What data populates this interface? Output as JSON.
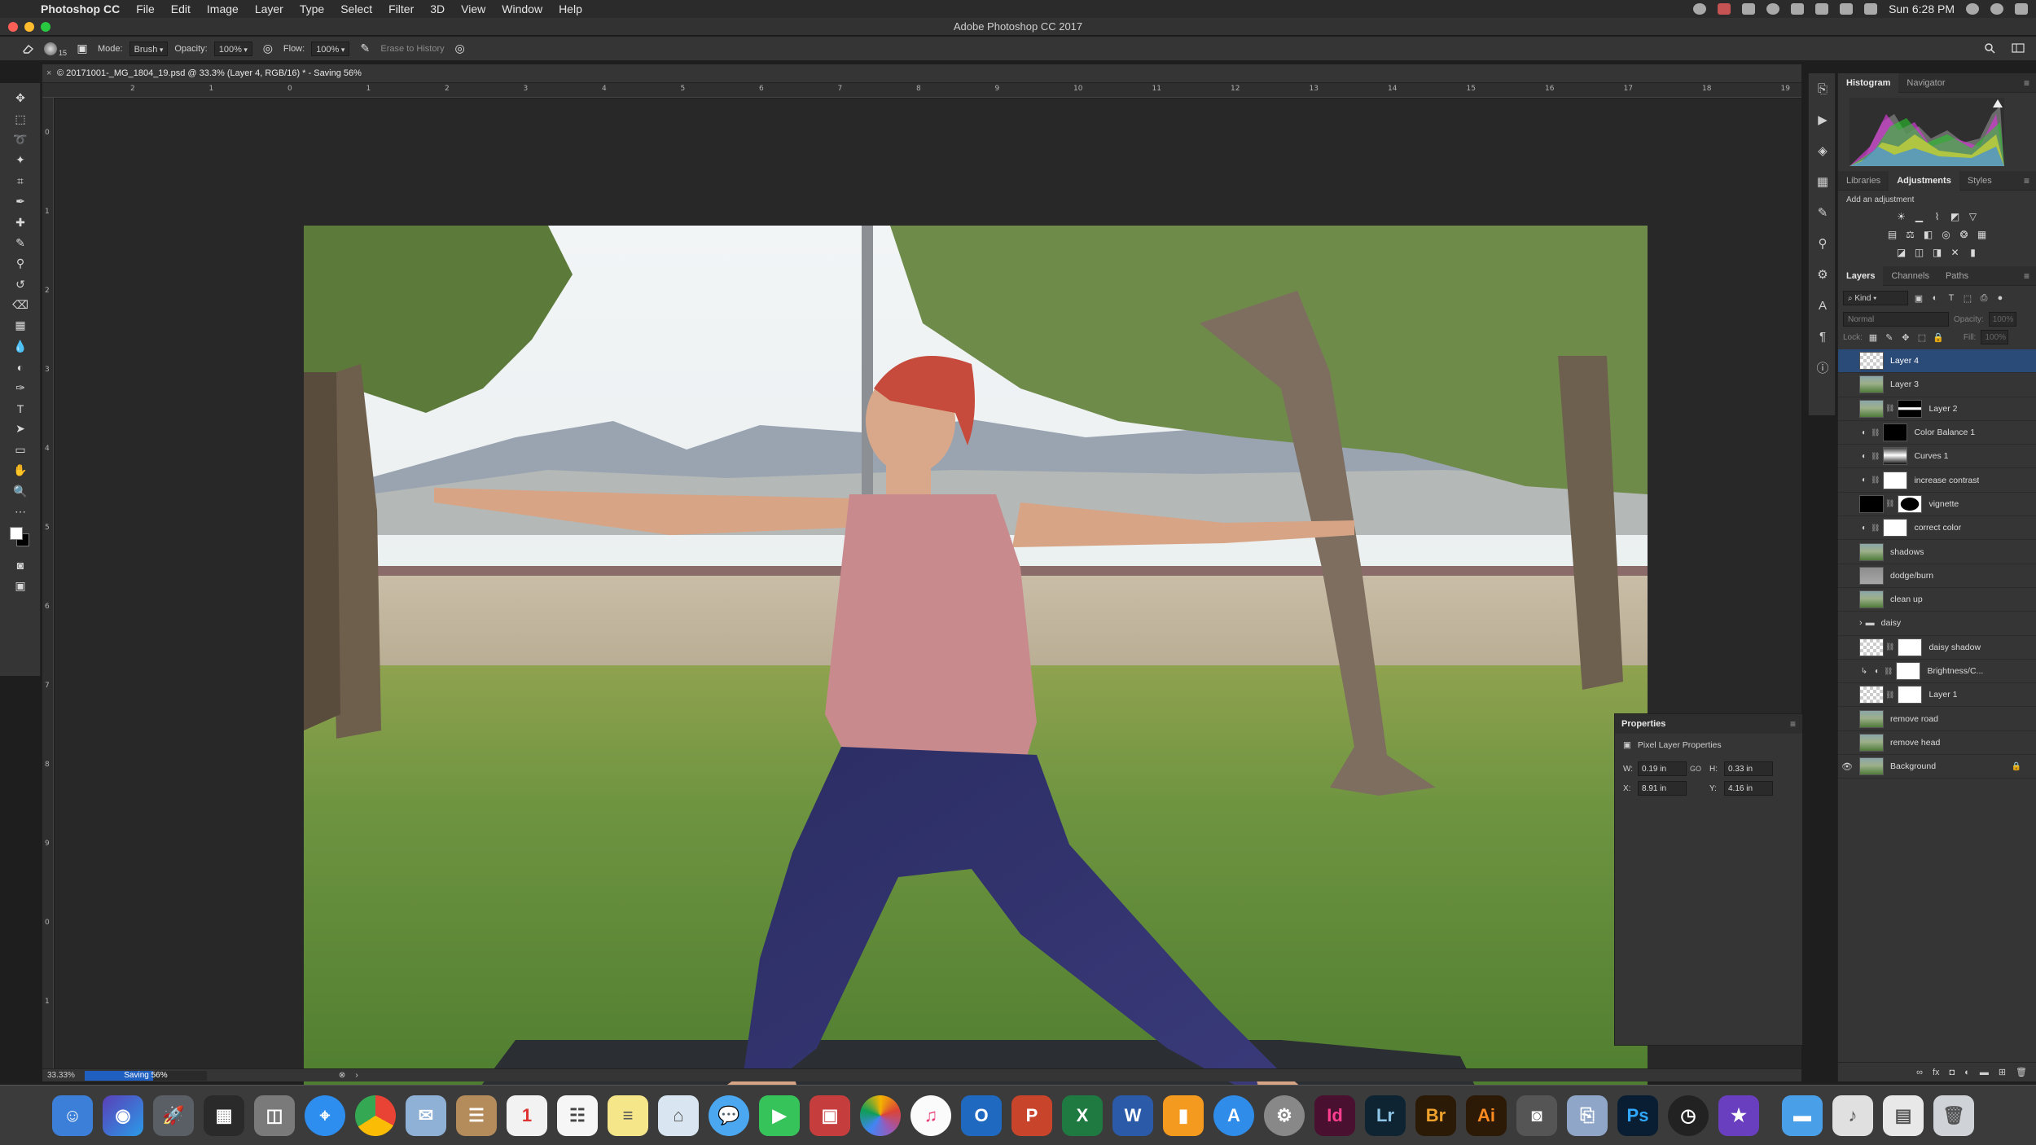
{
  "menubar": {
    "app_name": "Photoshop CC",
    "items": [
      "File",
      "Edit",
      "Image",
      "Layer",
      "Type",
      "Select",
      "Filter",
      "3D",
      "View",
      "Window",
      "Help"
    ],
    "clock": "Sun 6:28 PM"
  },
  "window": {
    "title": "Adobe Photoshop CC 2017"
  },
  "options_bar": {
    "brush_size": "15",
    "mode_label": "Mode:",
    "mode_value": "Brush",
    "opacity_label": "Opacity:",
    "opacity_value": "100%",
    "flow_label": "Flow:",
    "flow_value": "100%",
    "erase_to_history": "Erase to History"
  },
  "document": {
    "tab_title": "© 20171001-_MG_1804_19.psd @ 33.3% (Layer 4, RGB/16) * - Saving 56%"
  },
  "rulers": {
    "h_ticks": [
      "2",
      "1",
      "0",
      "1",
      "2",
      "3",
      "4",
      "5",
      "6",
      "7",
      "8",
      "9",
      "10",
      "11",
      "12",
      "13",
      "14",
      "15",
      "16",
      "17",
      "18",
      "19"
    ],
    "v_ticks": [
      "0",
      "1",
      "2",
      "3",
      "4",
      "5",
      "6",
      "7",
      "8",
      "9",
      "0",
      "1"
    ]
  },
  "status": {
    "zoom": "33.33%",
    "saving_label": "Saving 56%",
    "saving_progress": 0.56
  },
  "panels": {
    "histogram_tabs": [
      "Histogram",
      "Navigator"
    ],
    "adjust_tabs": [
      "Libraries",
      "Adjustments",
      "Styles"
    ],
    "add_adjustment": "Add an adjustment",
    "layer_tabs": [
      "Layers",
      "Channels",
      "Paths"
    ],
    "kind_label": "Kind",
    "blend_mode": "Normal",
    "opacity_label": "Opacity:",
    "opacity_value": "100%",
    "lock_label": "Lock:",
    "fill_label": "Fill:",
    "fill_value": "100%"
  },
  "layers": [
    {
      "name": "Layer 4",
      "selected": true
    },
    {
      "name": "Layer 3"
    },
    {
      "name": "Layer 2"
    },
    {
      "name": "Color Balance 1"
    },
    {
      "name": "Curves 1"
    },
    {
      "name": "increase contrast"
    },
    {
      "name": "vignette"
    },
    {
      "name": "correct color"
    },
    {
      "name": "shadows"
    },
    {
      "name": "dodge/burn"
    },
    {
      "name": "clean up"
    },
    {
      "name": "daisy"
    },
    {
      "name": "daisy shadow"
    },
    {
      "name": "Brightness/C..."
    },
    {
      "name": "Layer 1"
    },
    {
      "name": "remove road"
    },
    {
      "name": "remove head"
    },
    {
      "name": "Background"
    }
  ],
  "properties": {
    "title": "Properties",
    "subtitle": "Pixel Layer Properties",
    "w_label": "W:",
    "w_value": "0.19 in",
    "h_label": "H:",
    "h_value": "0.33 in",
    "x_label": "X:",
    "x_value": "8.91 in",
    "y_label": "Y:",
    "y_value": "4.16 in",
    "link_glyph": "GO"
  },
  "dock": {
    "labels": [
      "Id",
      "Lr",
      "Br",
      "Ai",
      "Ps"
    ]
  }
}
